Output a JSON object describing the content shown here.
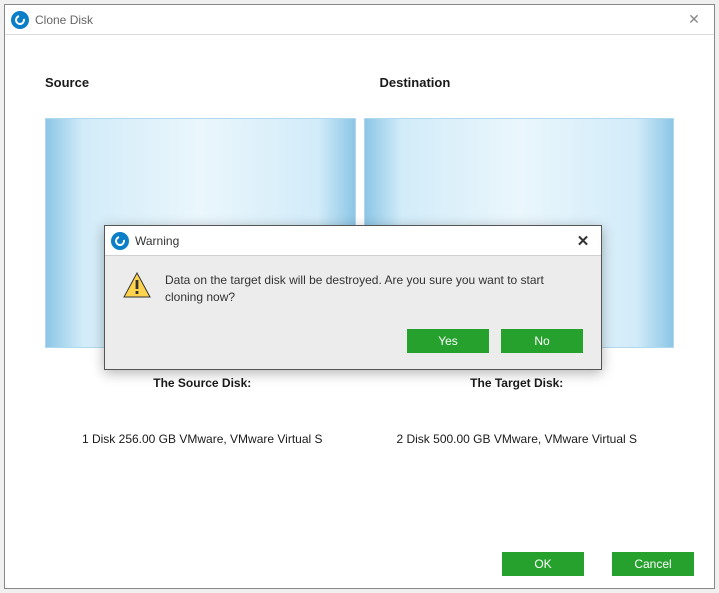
{
  "mainWindow": {
    "title": "Clone Disk",
    "sourceHeader": "Source",
    "destinationHeader": "Destination",
    "sourceDiskLabel": "The Source Disk:",
    "targetDiskLabel": "The Target Disk:",
    "sourceDiskDesc": "1 Disk 256.00 GB VMware,  VMware Virtual S",
    "targetDiskDesc": "2 Disk 500.00 GB VMware,  VMware Virtual S",
    "okLabel": "OK",
    "cancelLabel": "Cancel"
  },
  "warningDialog": {
    "title": "Warning",
    "message": "Data on the target disk will be destroyed. Are you sure you want to start cloning now?",
    "yesLabel": "Yes",
    "noLabel": "No"
  }
}
